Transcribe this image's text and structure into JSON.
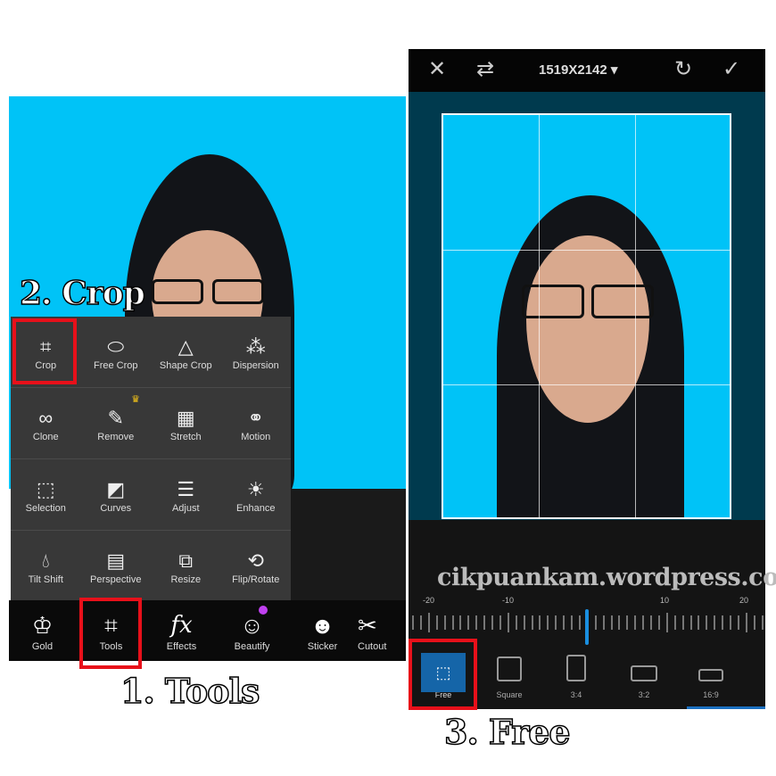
{
  "left_screen": {
    "tools_menu": [
      [
        {
          "label": "Crop",
          "icon": "crop-icon"
        },
        {
          "label": "Free Crop",
          "icon": "free-crop-icon"
        },
        {
          "label": "Shape Crop",
          "icon": "shape-crop-icon"
        },
        {
          "label": "Dispersion",
          "icon": "dispersion-icon"
        }
      ],
      [
        {
          "label": "Clone",
          "icon": "clone-icon"
        },
        {
          "label": "Remove",
          "icon": "remove-icon",
          "premium": true
        },
        {
          "label": "Stretch",
          "icon": "stretch-icon"
        },
        {
          "label": "Motion",
          "icon": "motion-icon"
        }
      ],
      [
        {
          "label": "Selection",
          "icon": "selection-icon"
        },
        {
          "label": "Curves",
          "icon": "curves-icon"
        },
        {
          "label": "Adjust",
          "icon": "adjust-icon"
        },
        {
          "label": "Enhance",
          "icon": "enhance-icon"
        }
      ],
      [
        {
          "label": "Tilt Shift",
          "icon": "tilt-shift-icon"
        },
        {
          "label": "Perspective",
          "icon": "perspective-icon"
        },
        {
          "label": "Resize",
          "icon": "resize-icon"
        },
        {
          "label": "Flip/Rotate",
          "icon": "flip-rotate-icon"
        }
      ]
    ],
    "bottom_bar": [
      {
        "label": "Gold",
        "icon": "crown-icon"
      },
      {
        "label": "Tools",
        "icon": "crop-icon"
      },
      {
        "label": "Effects",
        "icon": "fx-icon"
      },
      {
        "label": "Beautify",
        "icon": "beautify-icon",
        "badge_color": "#c040f0"
      },
      {
        "label": "Sticker",
        "icon": "sticker-icon"
      },
      {
        "label": "Cutout",
        "icon": "cutout-icon"
      }
    ]
  },
  "right_screen": {
    "dimensions": "1519X2142",
    "ruler_labels": [
      "-20",
      "-10",
      "10",
      "20"
    ],
    "ruler_value": 0,
    "aspect_options": [
      {
        "label": "Free",
        "selected": true
      },
      {
        "label": "Square"
      },
      {
        "label": "3:4"
      },
      {
        "label": "3:2"
      },
      {
        "label": "16:9"
      }
    ]
  },
  "watermark": "cikpuankam.wordpress.com",
  "callouts": {
    "step1": "1. Tools",
    "step2": "2. Crop",
    "step3": "3. Free"
  },
  "colors": {
    "highlight": "#e8101a",
    "accent": "#1a8fe0",
    "photo_bg": "#00c3f7"
  }
}
